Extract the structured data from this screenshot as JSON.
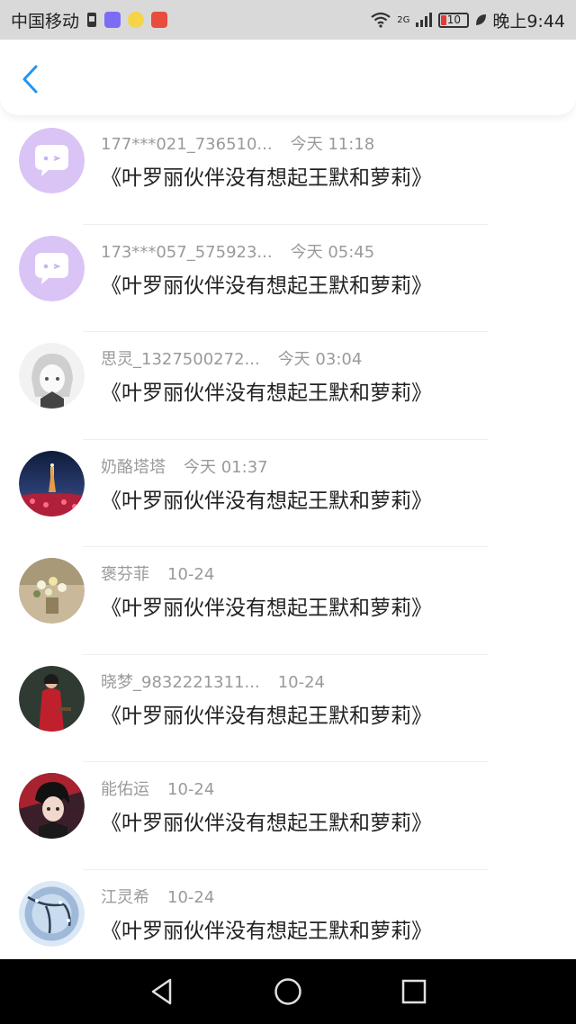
{
  "status_bar": {
    "carrier": "中国移动",
    "network": "2G",
    "battery": "10",
    "time": "晚上9:44"
  },
  "messages": [
    {
      "name": "177***021_736510...",
      "time": "今天 11:18",
      "text": "《叶罗丽伙伴没有想起王默和萝莉》",
      "avatar": "chat-bubble-avatar"
    },
    {
      "name": "173***057_575923...",
      "time": "今天 05:45",
      "text": "《叶罗丽伙伴没有想起王默和萝莉》",
      "avatar": "chat-bubble-avatar"
    },
    {
      "name": "思灵_1327500272...",
      "time": "今天 03:04",
      "text": "《叶罗丽伙伴没有想起王默和萝莉》",
      "avatar": "anime-girl-sketch-avatar"
    },
    {
      "name": "奶酪塔塔",
      "time": "今天 01:37",
      "text": "《叶罗丽伙伴没有想起王默和萝莉》",
      "avatar": "night-tower-avatar"
    },
    {
      "name": "褒芬菲",
      "time": "10-24",
      "text": "《叶罗丽伙伴没有想起王默和萝莉》",
      "avatar": "flowers-avatar"
    },
    {
      "name": "晓梦_9832221311...",
      "time": "10-24",
      "text": "《叶罗丽伙伴没有想起王默和萝莉》",
      "avatar": "woman-red-dress-avatar"
    },
    {
      "name": "能佑运",
      "time": "10-24",
      "text": "《叶罗丽伙伴没有想起王默和萝莉》",
      "avatar": "anime-boy-avatar"
    },
    {
      "name": "江灵希",
      "time": "10-24",
      "text": "《叶罗丽伙伴没有想起王默和萝莉》",
      "avatar": "winter-tree-avatar"
    }
  ],
  "colors": {
    "accent": "#2196f3",
    "status_bar_bg": "#d9d9d9",
    "nav_bar_bg": "#000000",
    "meta_text": "#9a9a9a"
  }
}
